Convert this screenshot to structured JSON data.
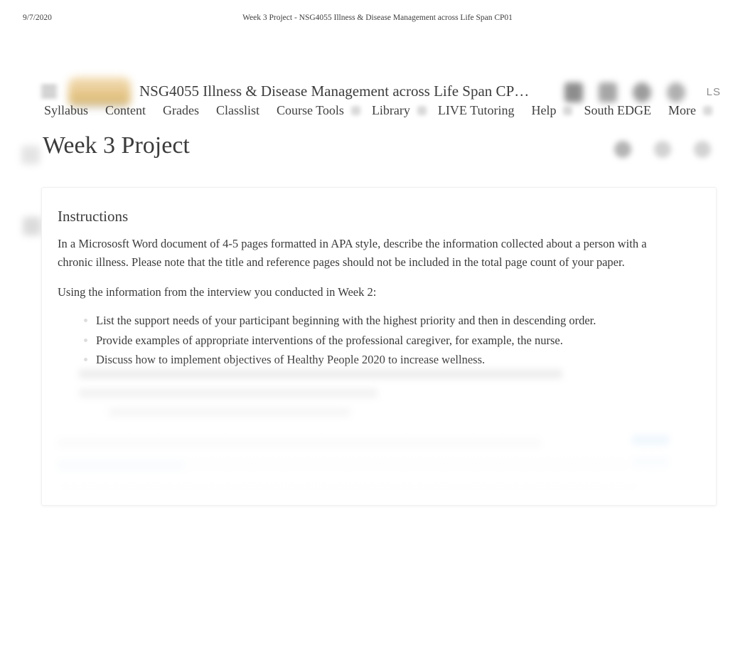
{
  "print_header": {
    "date": "9/7/2020",
    "title": "Week 3 Project - NSG4055 Illness & Disease Management across Life Span CP01"
  },
  "appbar": {
    "menu_icon": "hamburger-icon",
    "logo": "school-logo",
    "course_title": "NSG4055 Illness & Disease Management across Life Span CP…",
    "icons": [
      "messages-icon",
      "subscriptions-icon",
      "notifications-icon",
      "profile-icon"
    ],
    "avatar_initials": "LS"
  },
  "nav": {
    "items": [
      {
        "label": "Syllabus",
        "has_caret": false
      },
      {
        "label": "Content",
        "has_caret": false
      },
      {
        "label": "Grades",
        "has_caret": false
      },
      {
        "label": "Classlist",
        "has_caret": false
      },
      {
        "label": "Course Tools",
        "has_caret": true
      },
      {
        "label": "Library",
        "has_caret": true
      },
      {
        "label": "LIVE Tutoring",
        "has_caret": false
      },
      {
        "label": "Help",
        "has_caret": true
      },
      {
        "label": "South EDGE",
        "has_caret": false
      },
      {
        "label": "More",
        "has_caret": true
      }
    ]
  },
  "page": {
    "title": "Week 3 Project",
    "actions": [
      "print-icon",
      "settings-icon",
      "more-options-icon"
    ]
  },
  "content": {
    "heading": "Instructions",
    "paragraph_1": "In a Micrososft Word document of 4-5 pages formatted in APA style, describe the information collected about a person with a chronic illness.  Please note   that the title and reference pages should not be included in the total page count of your paper.",
    "paragraph_2": "Using the information from the interview you conducted in Week 2:",
    "bullets": [
      "List the support needs of your participant beginning with the highest priority and then in descending order.",
      "Provide examples of appropriate interventions of the professional caregiver, for example, the nurse.",
      "Discuss how to implement objectives of Healthy People 2020 to increase wellness."
    ]
  },
  "colors": {
    "link": "#7fc0ee",
    "text": "#3a3a3a",
    "logo_gold": "#dcb96f"
  }
}
